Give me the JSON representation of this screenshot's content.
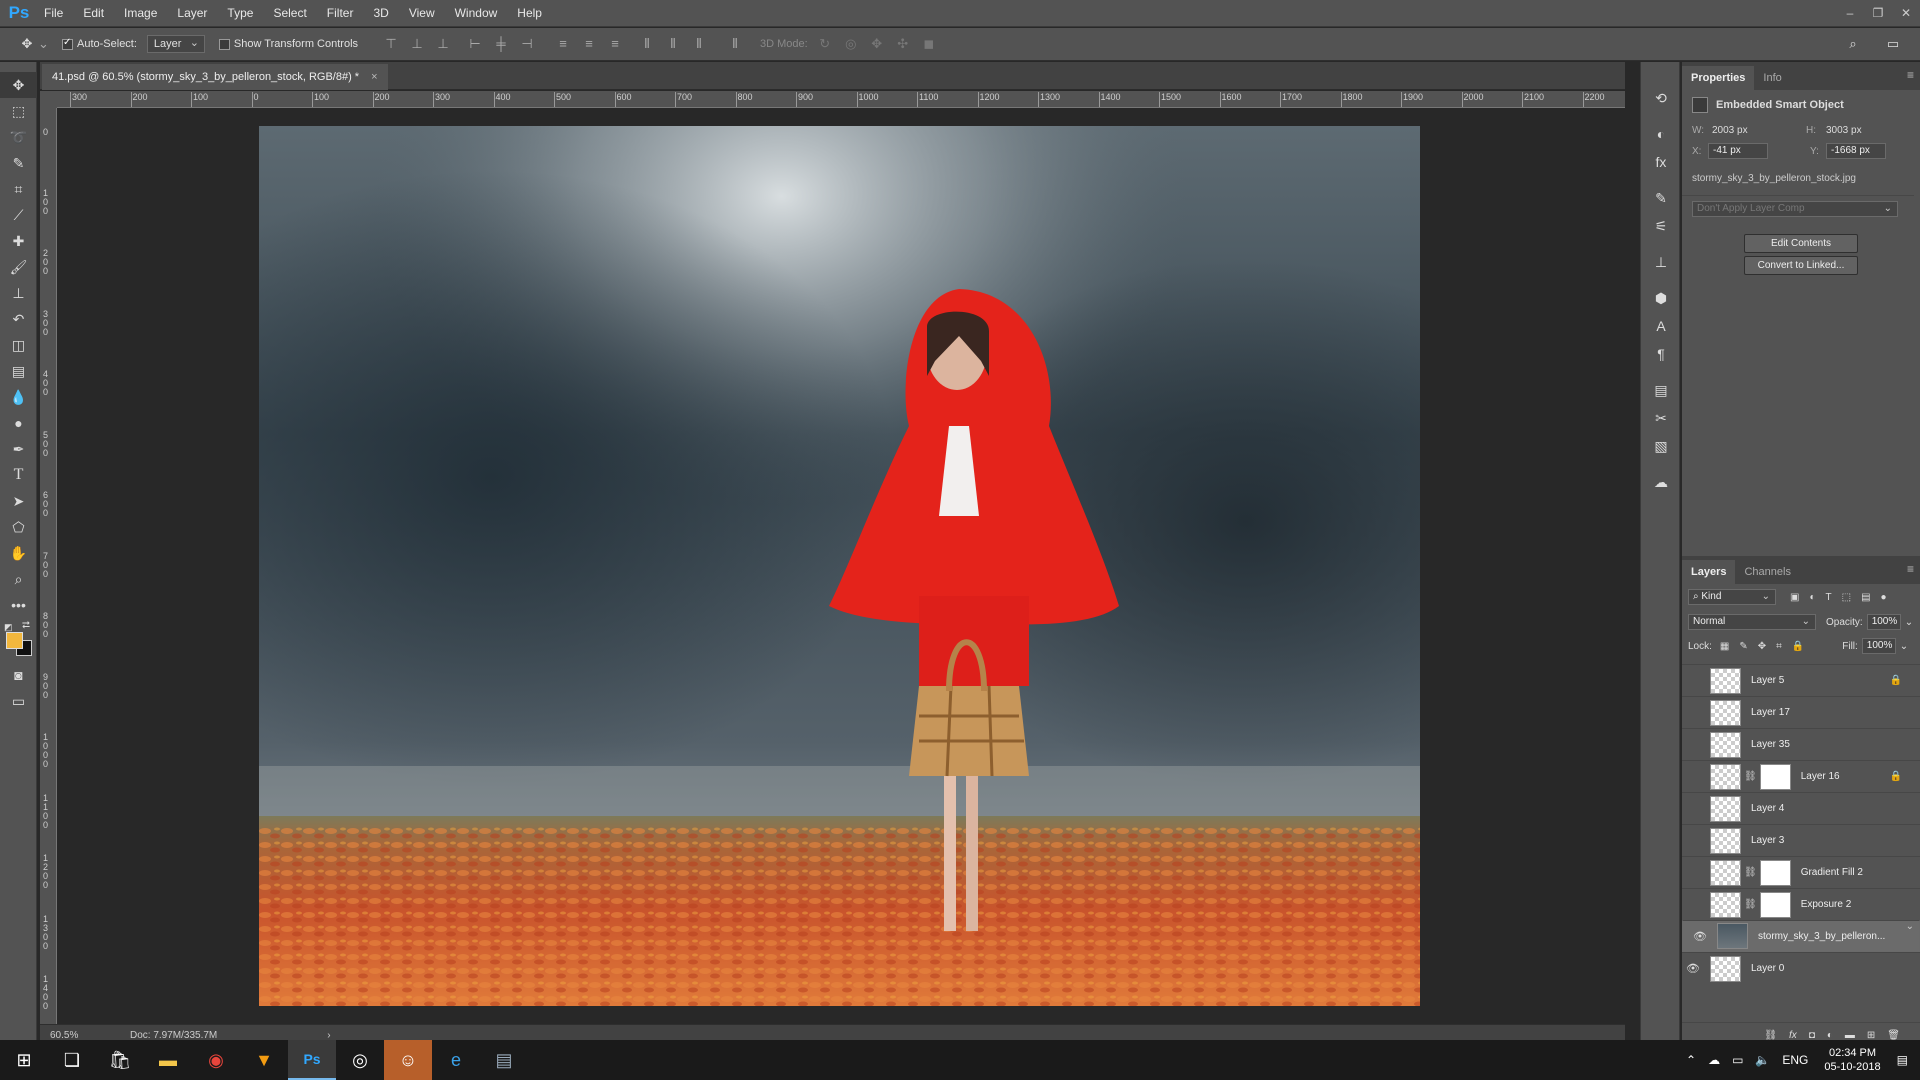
{
  "app": {
    "logo": "Ps"
  },
  "menu": [
    "File",
    "Edit",
    "Image",
    "Layer",
    "Type",
    "Select",
    "Filter",
    "3D",
    "View",
    "Window",
    "Help"
  ],
  "window_controls": [
    "–",
    "❐",
    "✕"
  ],
  "options": {
    "auto_select_label": "Auto-Select:",
    "auto_select_value": "Layer",
    "show_transform_label": "Show Transform Controls",
    "mode_3d_label": "3D Mode:"
  },
  "document": {
    "tab_title": "41.psd @ 60.5% (stormy_sky_3_by_pelleron_stock, RGB/8#) *",
    "close": "×",
    "zoom": "60.5%",
    "doc_size": "Doc: 7.97M/335.7M"
  },
  "ruler_h": [
    "300",
    "200",
    "100",
    "0",
    "100",
    "200",
    "300",
    "400",
    "500",
    "600",
    "700",
    "800",
    "900",
    "1000",
    "1100",
    "1200",
    "1300",
    "1400",
    "1500",
    "1600",
    "1700",
    "1800",
    "1900",
    "2000",
    "2100",
    "2200"
  ],
  "ruler_v": [
    "0",
    "100",
    "200",
    "300",
    "400",
    "500",
    "600",
    "700",
    "800",
    "900",
    "1000",
    "1100",
    "1200",
    "1300",
    "1400"
  ],
  "properties": {
    "tabs": [
      "Properties",
      "Info"
    ],
    "object_type": "Embedded Smart Object",
    "w_label": "W:",
    "w_value": "2003 px",
    "h_label": "H:",
    "h_value": "3003 px",
    "x_label": "X:",
    "x_value": "-41 px",
    "y_label": "Y:",
    "y_value": "-1668 px",
    "filename": "stormy_sky_3_by_pelleron_stock.jpg",
    "layer_comp": "Don't Apply Layer Comp",
    "edit_contents": "Edit Contents",
    "convert_linked": "Convert to Linked..."
  },
  "layers_panel": {
    "tabs": [
      "Layers",
      "Channels"
    ],
    "kind": "Kind",
    "blend_mode": "Normal",
    "opacity_label": "Opacity:",
    "opacity_value": "100%",
    "lock_label": "Lock:",
    "fill_label": "Fill:",
    "fill_value": "100%",
    "layers": [
      {
        "name": "Layer 5",
        "visible": false,
        "locked": true
      },
      {
        "name": "Layer 17",
        "visible": false
      },
      {
        "name": "Layer 35",
        "visible": false
      },
      {
        "name": "Layer 16",
        "visible": false,
        "mask": true,
        "locked": true
      },
      {
        "name": "Layer 4",
        "visible": false
      },
      {
        "name": "Layer 3",
        "visible": false
      },
      {
        "name": "Gradient Fill 2",
        "visible": false,
        "mask": true
      },
      {
        "name": "Exposure 2",
        "visible": false,
        "mask": true
      },
      {
        "name": "stormy_sky_3_by_pelleron...",
        "visible": true,
        "selected": true
      },
      {
        "name": "Layer 0",
        "visible": true
      }
    ],
    "footer_icons": [
      "link-icon",
      "fx-icon",
      "mask-icon",
      "adjustment-icon",
      "folder-icon",
      "new-layer-icon",
      "trash-icon"
    ]
  },
  "taskbar": {
    "lang": "ENG",
    "time": "02:34 PM",
    "date": "05-10-2018"
  },
  "colors": {
    "foreground": "#f2b73d",
    "background": "#111111",
    "accent": "#31a8ff"
  }
}
